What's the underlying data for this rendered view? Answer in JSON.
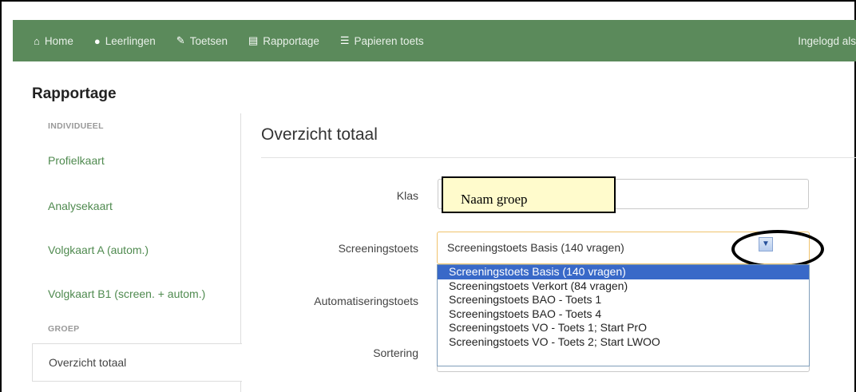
{
  "nav": {
    "items": [
      {
        "icon": "home-icon",
        "glyph": "🏠",
        "label": "Home"
      },
      {
        "icon": "user-icon",
        "glyph": "👤",
        "label": "Leerlingen"
      },
      {
        "icon": "pencil-icon",
        "glyph": "✎",
        "label": "Toetsen"
      },
      {
        "icon": "report-icon",
        "glyph": "▤",
        "label": "Rapportage"
      },
      {
        "icon": "list-icon",
        "glyph": "☰",
        "label": "Papieren toets"
      }
    ],
    "logged_in_label": "Ingelogd als"
  },
  "page": {
    "title": "Rapportage"
  },
  "sidebar": {
    "section_individual": "INDIVIDUEEL",
    "items": [
      {
        "label": "Profielkaart"
      },
      {
        "label": "Analysekaart"
      },
      {
        "label": "Volgkaart A (autom.)"
      },
      {
        "label": "Volgkaart B1 (screen. + autom.)"
      }
    ],
    "section_group": "GROEP",
    "active_item": "Overzicht totaal"
  },
  "main": {
    "title": "Overzicht totaal",
    "form": {
      "klas_label": "Klas",
      "klas_value": "",
      "callout": "Naam groep",
      "screening_label": "Screeningstoets",
      "screening_value": "Screeningstoets Basis (140 vragen)",
      "screening_options": [
        "Screeningstoets Basis (140 vragen)",
        "Screeningstoets Verkort (84 vragen)",
        "Screeningstoets BAO - Toets 1",
        "Screeningstoets BAO - Toets 4",
        "Screeningstoets VO - Toets 1; Start PrO",
        "Screeningstoets VO - Toets 2; Start LWOO"
      ],
      "automatisering_label": "Automatiseringstoets",
      "sortering_label": "Sortering"
    }
  },
  "colors": {
    "navbar": "#5b8a5b",
    "link": "#4f8a4f",
    "highlight": "#3969c8"
  }
}
